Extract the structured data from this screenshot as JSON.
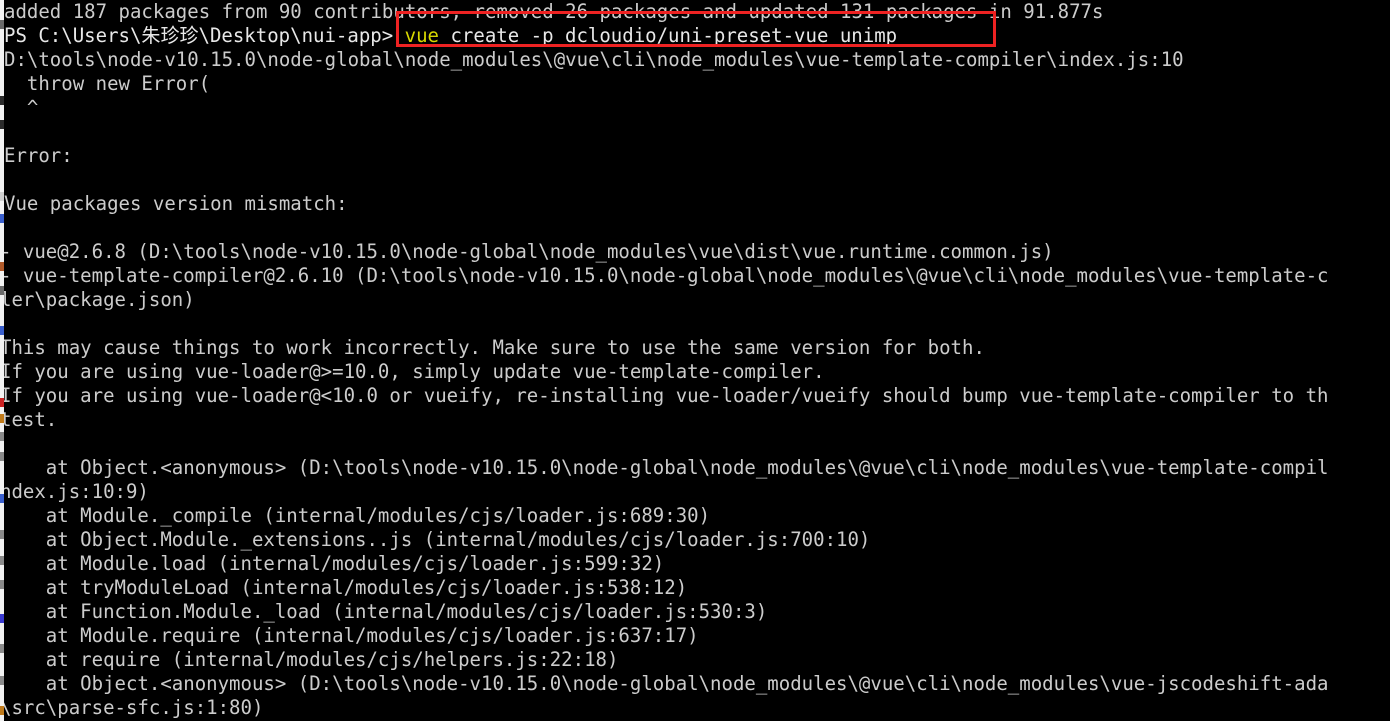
{
  "terminal": {
    "type": "powershell-console",
    "background_color": "#000000",
    "foreground_color": "#cccccc",
    "prompt_command_color": "#d7d700",
    "annotation_color": "#ee2222",
    "lines": [
      {
        "id": "npm-summary",
        "text": "added 187 packages from 90 contributors, removed 26 packages and updated 131 packages in 91.877s"
      },
      {
        "id": "prompt-command",
        "text": "PS C:\\Users\\朱珍珍\\Desktop\\nui-app> vue create -p dcloudio/uni-preset-vue unimp"
      },
      {
        "id": "error-file-path",
        "text": "D:\\tools\\node-v10.15.0\\node-global\\node_modules\\@vue\\cli\\node_modules\\vue-template-compiler\\index.js:10"
      },
      {
        "id": "throw-statement",
        "text": "  throw new Error("
      },
      {
        "id": "caret-marker",
        "text": "  ^"
      },
      {
        "id": "blank-1",
        "text": ""
      },
      {
        "id": "error-label",
        "text": "Error:"
      },
      {
        "id": "blank-2",
        "text": ""
      },
      {
        "id": "mismatch-heading",
        "text": "Vue packages version mismatch:"
      },
      {
        "id": "blank-3",
        "text": ""
      },
      {
        "id": "pkg-vue",
        "text": "- vue@2.6.8 (D:\\tools\\node-v10.15.0\\node-global\\node_modules\\vue\\dist\\vue.runtime.common.js)"
      },
      {
        "id": "pkg-vtc",
        "text": "- vue-template-compiler@2.6.10 (D:\\tools\\node-v10.15.0\\node-global\\node_modules\\@vue\\cli\\node_modules\\vue-template-c"
      },
      {
        "id": "pkg-vtc-wrap",
        "text": "ler\\package.json)"
      },
      {
        "id": "blank-4",
        "text": ""
      },
      {
        "id": "advice-1",
        "text": "This may cause things to work incorrectly. Make sure to use the same version for both."
      },
      {
        "id": "advice-2",
        "text": "If you are using vue-loader@>=10.0, simply update vue-template-compiler."
      },
      {
        "id": "advice-3",
        "text": "If you are using vue-loader@<10.0 or vueify, re-installing vue-loader/vueify should bump vue-template-compiler to th"
      },
      {
        "id": "advice-3-wrap",
        "text": "test."
      },
      {
        "id": "blank-5",
        "text": ""
      },
      {
        "id": "stack-1",
        "text": "    at Object.<anonymous> (D:\\tools\\node-v10.15.0\\node-global\\node_modules\\@vue\\cli\\node_modules\\vue-template-compil"
      },
      {
        "id": "stack-1-wrap",
        "text": "ndex.js:10:9)"
      },
      {
        "id": "stack-2",
        "text": "    at Module._compile (internal/modules/cjs/loader.js:689:30)"
      },
      {
        "id": "stack-3",
        "text": "    at Object.Module._extensions..js (internal/modules/cjs/loader.js:700:10)"
      },
      {
        "id": "stack-4",
        "text": "    at Module.load (internal/modules/cjs/loader.js:599:32)"
      },
      {
        "id": "stack-5",
        "text": "    at tryModuleLoad (internal/modules/cjs/loader.js:538:12)"
      },
      {
        "id": "stack-6",
        "text": "    at Function.Module._load (internal/modules/cjs/loader.js:530:3)"
      },
      {
        "id": "stack-7",
        "text": "    at Module.require (internal/modules/cjs/loader.js:637:17)"
      },
      {
        "id": "stack-8",
        "text": "    at require (internal/modules/cjs/helpers.js:22:18)"
      },
      {
        "id": "stack-9",
        "text": "    at Object.<anonymous> (D:\\tools\\node-v10.15.0\\node-global\\node_modules\\@vue\\cli\\node_modules\\vue-jscodeshift-ada"
      },
      {
        "id": "stack-9-wrap",
        "text": "\\src\\parse-sfc.js:1:80)"
      }
    ],
    "prompt_line_parts": {
      "prefix": "PS C:\\Users\\朱珍珍\\Desktop\\nui-app> ",
      "command_name": "vue",
      "command_args": " create -p dcloudio/uni-preset-vue unimp"
    }
  },
  "annotation": {
    "shape": "rectangle",
    "label": "highlight-around-vue-create-command",
    "color": "#ee2222"
  }
}
